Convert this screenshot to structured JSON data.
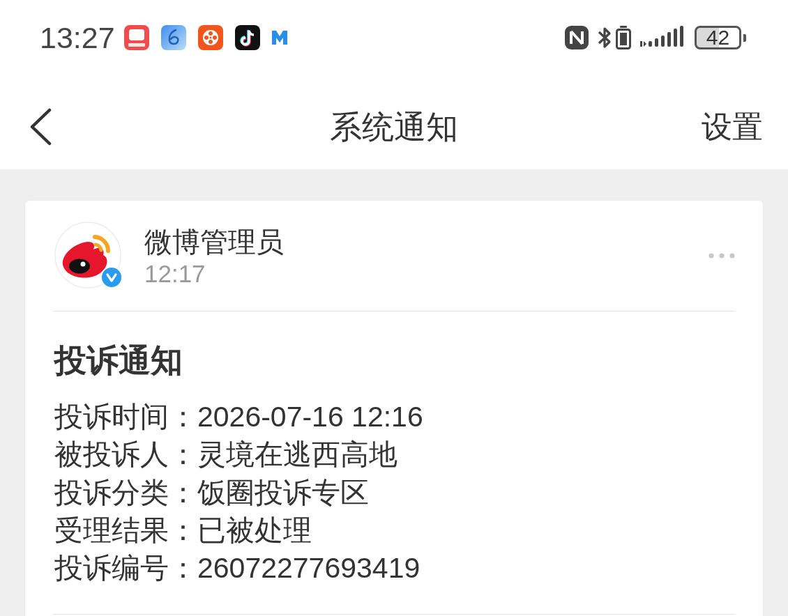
{
  "status_bar": {
    "time": "13:27",
    "battery": "42"
  },
  "nav_bar": {
    "title": "系统通知",
    "action": "设置"
  },
  "message": {
    "sender": "微博管理员",
    "time": "12:17",
    "verified": true,
    "title": "投诉通知",
    "lines": [
      "投诉时间：2026-07-16 12:16",
      "被投诉人：灵境在逃西高地",
      "投诉分类：饭圈投诉专区",
      "受理结果：已被处理",
      "投诉编号：26072277693419"
    ]
  }
}
